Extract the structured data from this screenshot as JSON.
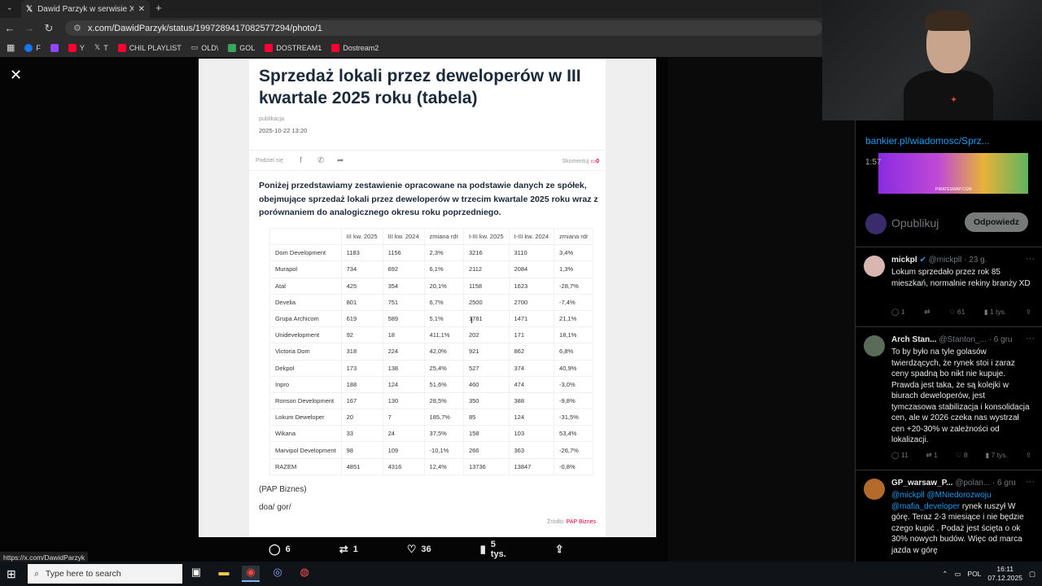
{
  "browser": {
    "tab_title": "Dawid Parzyk w serwisie X: „Sp",
    "url": "x.com/DawidParzyk/status/1997289417082577294/photo/1",
    "bookmarks": [
      {
        "label": "F",
        "color": "#1877f2"
      },
      {
        "label": "",
        "color": "#9146ff"
      },
      {
        "label": "Y",
        "color": "#ff0033"
      },
      {
        "label": "T",
        "color": "#ffffff"
      },
      {
        "label": "CHIL PLAYLIST",
        "color": "#ff0033"
      },
      {
        "label": "OLD\\",
        "color": "#888888"
      },
      {
        "label": "GOL",
        "color": "#3aa55d"
      },
      {
        "label": "DOSTREAM1",
        "color": "#ff0033"
      },
      {
        "label": "Dostream2",
        "color": "#ff0033"
      }
    ]
  },
  "article": {
    "title": "Sprzedaż lokali przez deweloperów w III kwartale 2025 roku (tabela)",
    "pub_label": "publikacja",
    "pub_date": "2025-10-22 13:20",
    "share_label": "Podziel się",
    "comments_label": "Skomentuj",
    "comments_count": "0",
    "lead": "Poniżej przedstawiamy zestawienie opracowane na podstawie danych ze spółek, obejmujące sprzedaż lokali przez deweloperów w trzecim kwartale 2025 roku wraz z porównaniem do analogicznego okresu roku poprzedniego.",
    "table_headers": [
      "",
      "III kw. 2025",
      "III kw. 2024",
      "zmiana rdr",
      "I-III kw. 2025",
      "I-III kw. 2024",
      "zmiana rdr"
    ],
    "table_rows": [
      [
        "Dom Development",
        "1183",
        "1156",
        "2,3%",
        "3216",
        "3110",
        "3,4%"
      ],
      [
        "Murapol",
        "734",
        "692",
        "6,1%",
        "2112",
        "2084",
        "1,3%"
      ],
      [
        "Atal",
        "425",
        "354",
        "20,1%",
        "1158",
        "1623",
        "-28,7%"
      ],
      [
        "Develia",
        "801",
        "751",
        "6,7%",
        "2500",
        "2700",
        "-7,4%"
      ],
      [
        "Grupa Archicom",
        "619",
        "589",
        "5,1%",
        "1781",
        "1471",
        "21,1%"
      ],
      [
        "Unidevelopment",
        "92",
        "18",
        "411,1%",
        "202",
        "171",
        "18,1%"
      ],
      [
        "Victoria Dom",
        "318",
        "224",
        "42,0%",
        "921",
        "862",
        "6,8%"
      ],
      [
        "Dekpol",
        "173",
        "138",
        "25,4%",
        "527",
        "374",
        "40,9%"
      ],
      [
        "Inpro",
        "188",
        "124",
        "51,6%",
        "460",
        "474",
        "-3,0%"
      ],
      [
        "Ronson Development",
        "167",
        "130",
        "28,5%",
        "350",
        "388",
        "-9,8%"
      ],
      [
        "Lokum Deweloper",
        "20",
        "7",
        "185,7%",
        "85",
        "124",
        "-31,5%"
      ],
      [
        "Wikana",
        "33",
        "24",
        "37,5%",
        "158",
        "103",
        "53,4%"
      ],
      [
        "Marvipol Development",
        "98",
        "109",
        "-10,1%",
        "266",
        "363",
        "-26,7%"
      ],
      [
        "RAZEM",
        "4851",
        "4316",
        "12,4%",
        "13736",
        "13847",
        "-0,8%"
      ]
    ],
    "source1": "(PAP Biznes)",
    "source2": "doa/ gor/",
    "source_label": "Źródło:",
    "source_name": "PAP Biznes"
  },
  "actions": {
    "replies": "6",
    "reposts": "1",
    "likes": "36",
    "views": "5 tys."
  },
  "status_url": "https://x.com/DawidParzyk",
  "sidebar": {
    "link_text": "bankier.pl/wiadomosc/Sprz...",
    "preview_time": "1:57",
    "preview_caption": "PIRATESWAP.COM",
    "reply_placeholder": "Opublikuj",
    "reply_button": "Odpowiedz"
  },
  "tweets": [
    {
      "name": "mickpl",
      "handle": "@mickpll · 23 g.",
      "text": "Lokum sprzedało przez rok 85 mieszkań, normalnie rekiny branży XD",
      "replies": "1",
      "reposts": "",
      "likes": "61",
      "views": "1 tys.",
      "avatar_color": "#d9b7b0"
    },
    {
      "name": "Arch Stan...",
      "handle": "@Stanton_... · 6 gru",
      "text": "To by było na tyle golasów twierdzących, że rynek stoi i zaraz ceny spadną bo nikt nie kupuje. Prawda jest taka, że są kolejki w biurach deweloperów, jest tymczasowa stabilizacja i konsolidacja cen, ale w 2026 czeka nas wystrzał cen +20-30% w zależności od lokalizacji.",
      "replies": "11",
      "reposts": "1",
      "likes": "8",
      "views": "7 tys.",
      "avatar_color": "#5b6b5a"
    },
    {
      "name": "GP_warsaw_P...",
      "handle": "@polan... · 6 gru",
      "mentions": "@mickpll @MNiedorozwoju @mafia_developer",
      "text": "rynek ruszył W górę. Teraz 2-3 miesiące i nie będzie czego kupić . Podaż jest ścięta o ok 30% nowych budów. Więc od marca jazda w górę",
      "avatar_color": "#b36a2a"
    }
  ],
  "taskbar": {
    "search_placeholder": "Type here to search",
    "lang": "POL",
    "time": "16:11",
    "date": "07.12.2025"
  }
}
